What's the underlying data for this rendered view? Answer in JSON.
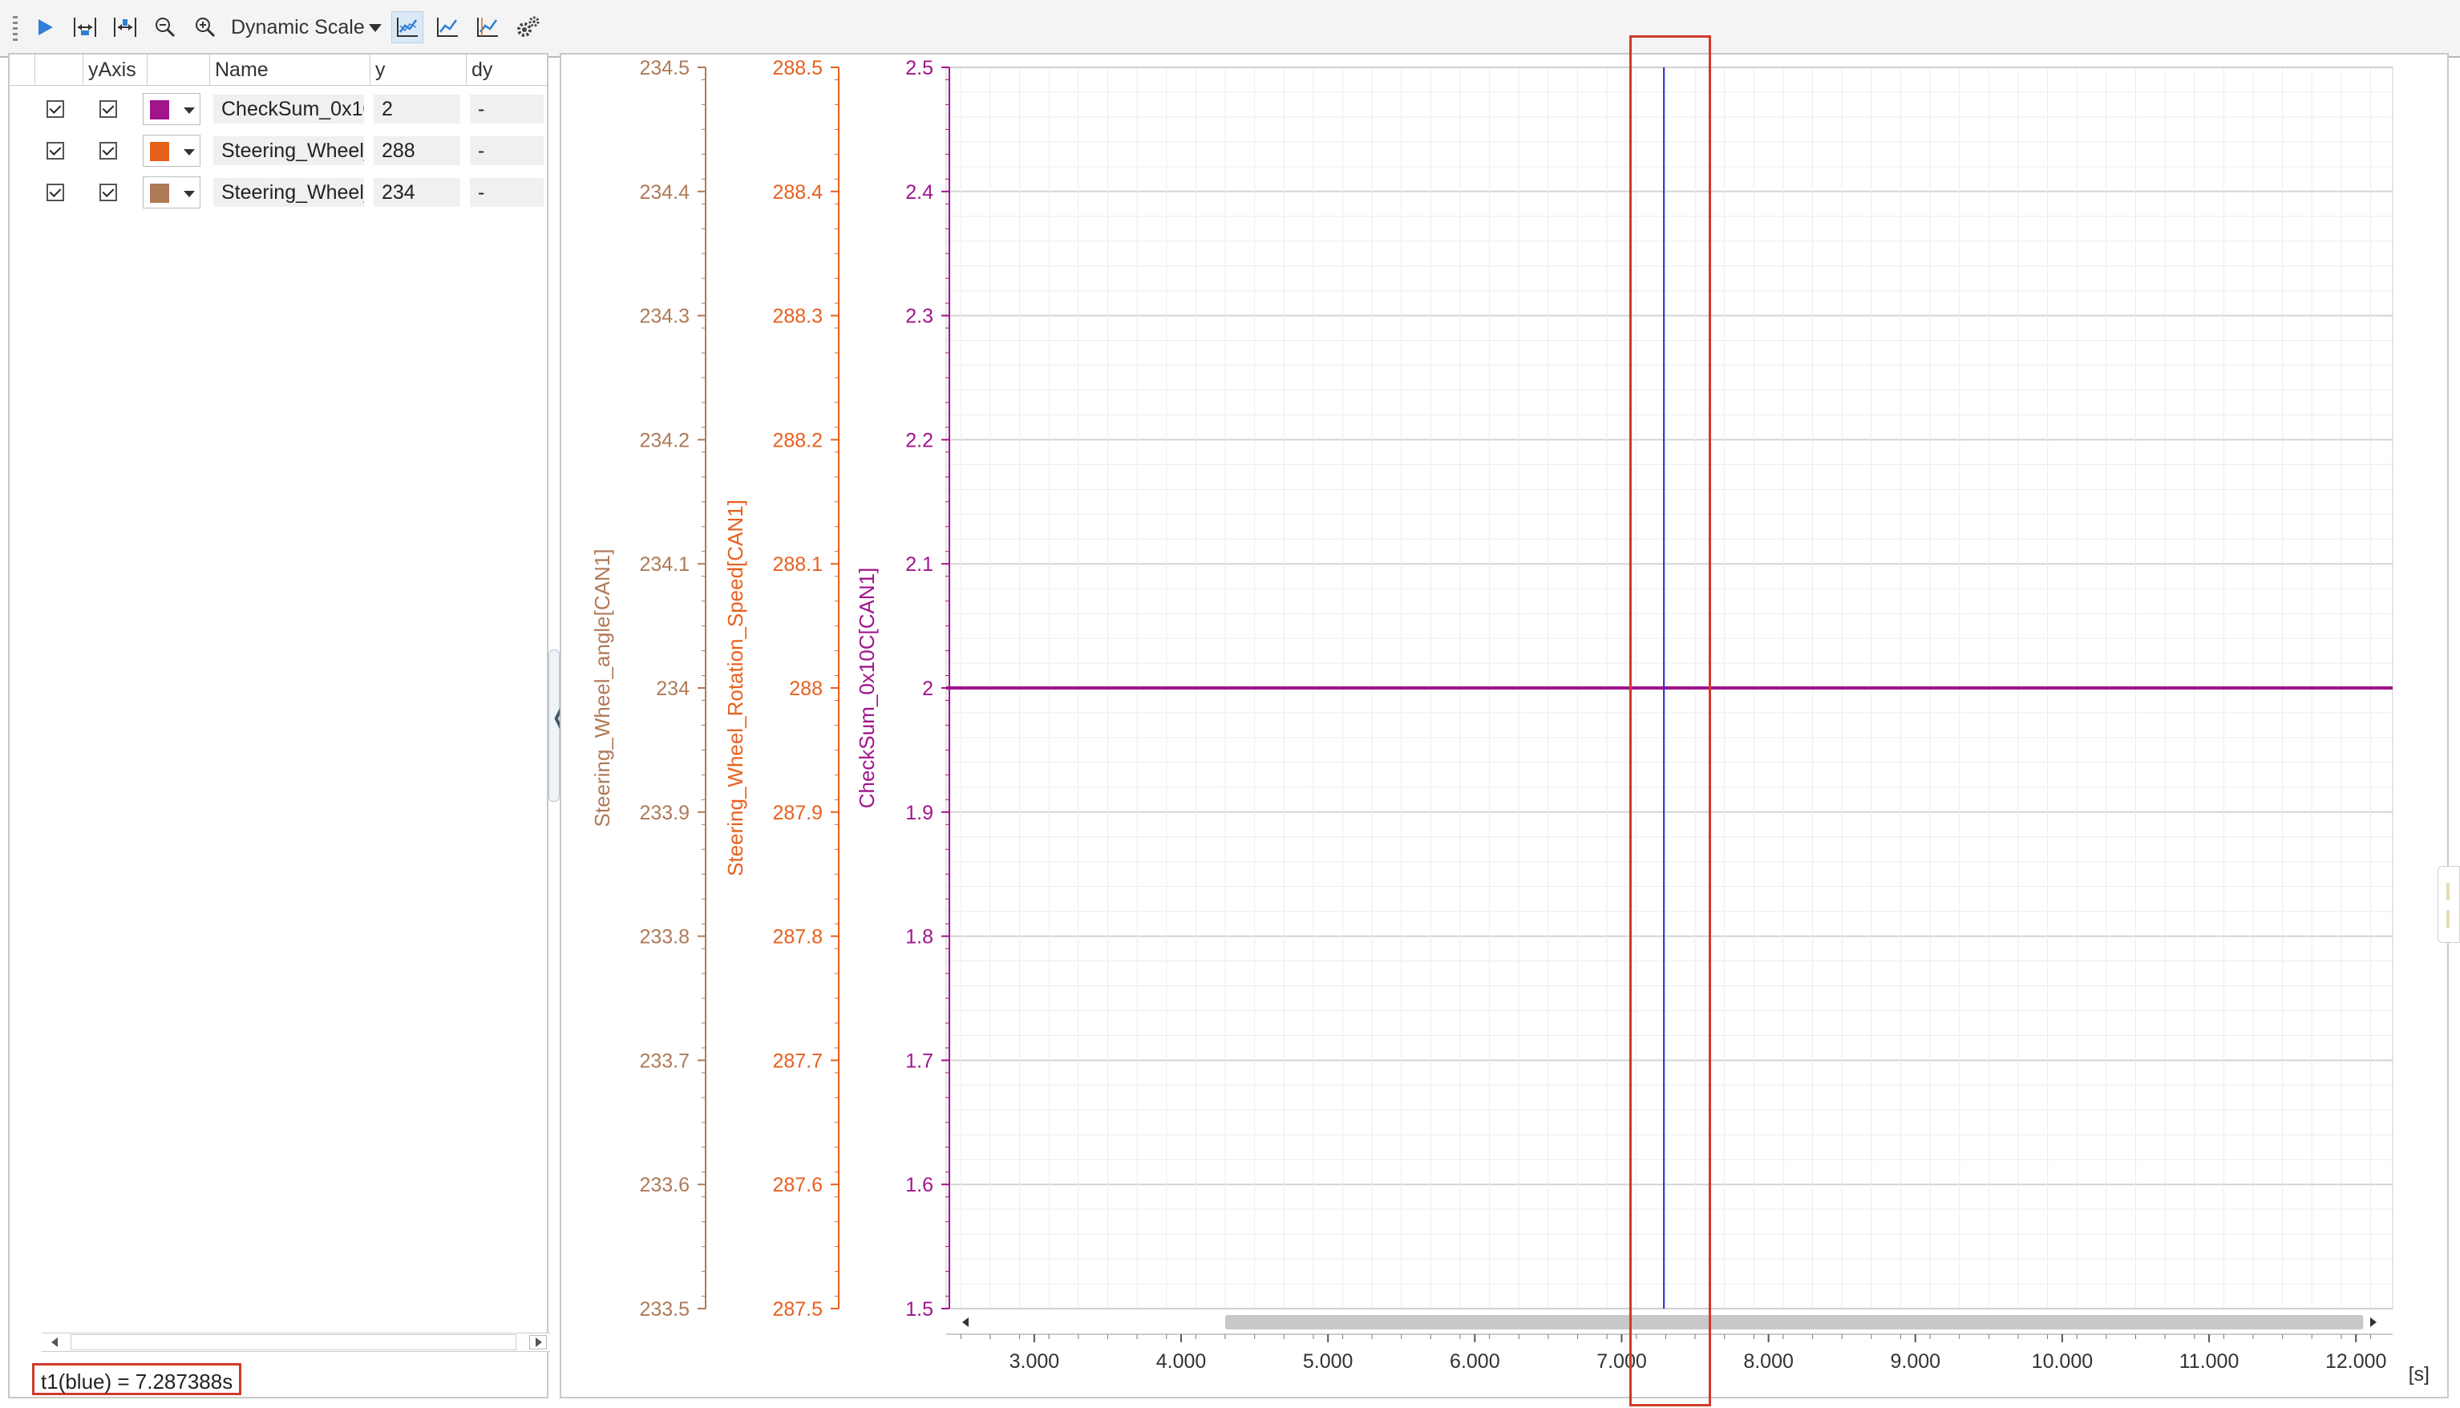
{
  "toolbar": {
    "scale_label": "Dynamic Scale",
    "icons": [
      "play-icon",
      "fit-x-icon",
      "fit-y-icon",
      "zoom-out-icon",
      "zoom-in-icon",
      "chart-mode-1-icon",
      "chart-mode-2-icon",
      "chart-mode-3-icon",
      "settings-icon"
    ]
  },
  "signal_table": {
    "headers": {
      "yaxis": "yAxis",
      "name": "Name",
      "y": "y",
      "dy": "dy"
    },
    "rows": [
      {
        "visible": true,
        "yaxis": true,
        "color": "#a0148c",
        "name": "CheckSum_0x10C[CAN1]",
        "y": "2",
        "dy": "-"
      },
      {
        "visible": true,
        "yaxis": true,
        "color": "#e8601e",
        "name": "Steering_Wheel_Rotation_Speed[CAN1]",
        "y": "288",
        "dy": "-"
      },
      {
        "visible": true,
        "yaxis": true,
        "color": "#b07a58",
        "name": "Steering_Wheel_angle[CAN1]",
        "y": "234",
        "dy": "-"
      }
    ]
  },
  "status": {
    "cursor_text": "t1(blue) = 7.287388s"
  },
  "chart_data": {
    "type": "line",
    "x": [
      2.4,
      12.25
    ],
    "xlim": [
      2.4,
      12.25
    ],
    "xticks": [
      "3.000",
      "4.000",
      "5.000",
      "6.000",
      "7.000",
      "8.000",
      "9.000",
      "10.000",
      "11.000",
      "12.000"
    ],
    "xunit": "[s]",
    "grid": true,
    "cursor": {
      "name": "t1",
      "color": "#2a2ad0",
      "x": 7.287388
    },
    "series": [
      {
        "name": "Steering_Wheel_angle[CAN1]",
        "color": "#b07a58",
        "ylim": [
          233.5,
          234.5
        ],
        "values": [
          234,
          234
        ],
        "yticks": [
          "234.5",
          "234.4",
          "234.3",
          "234.2",
          "234.1",
          "234",
          "233.9",
          "233.8",
          "233.7",
          "233.6",
          "233.5"
        ]
      },
      {
        "name": "Steering_Wheel_Rotation_Speed[CAN1]",
        "color": "#e8601e",
        "ylim": [
          287.5,
          288.5
        ],
        "values": [
          288,
          288
        ],
        "yticks": [
          "288.5",
          "288.4",
          "288.3",
          "288.2",
          "288.1",
          "288",
          "287.9",
          "287.8",
          "287.7",
          "287.6",
          "287.5"
        ]
      },
      {
        "name": "CheckSum_0x10C[CAN1]",
        "color": "#a0148c",
        "ylim": [
          1.5,
          2.5
        ],
        "values": [
          2,
          2
        ],
        "yticks": [
          "2.5",
          "2.4",
          "2.3",
          "2.2",
          "2.1",
          "2",
          "1.9",
          "1.8",
          "1.7",
          "1.6",
          "1.5"
        ]
      }
    ]
  }
}
